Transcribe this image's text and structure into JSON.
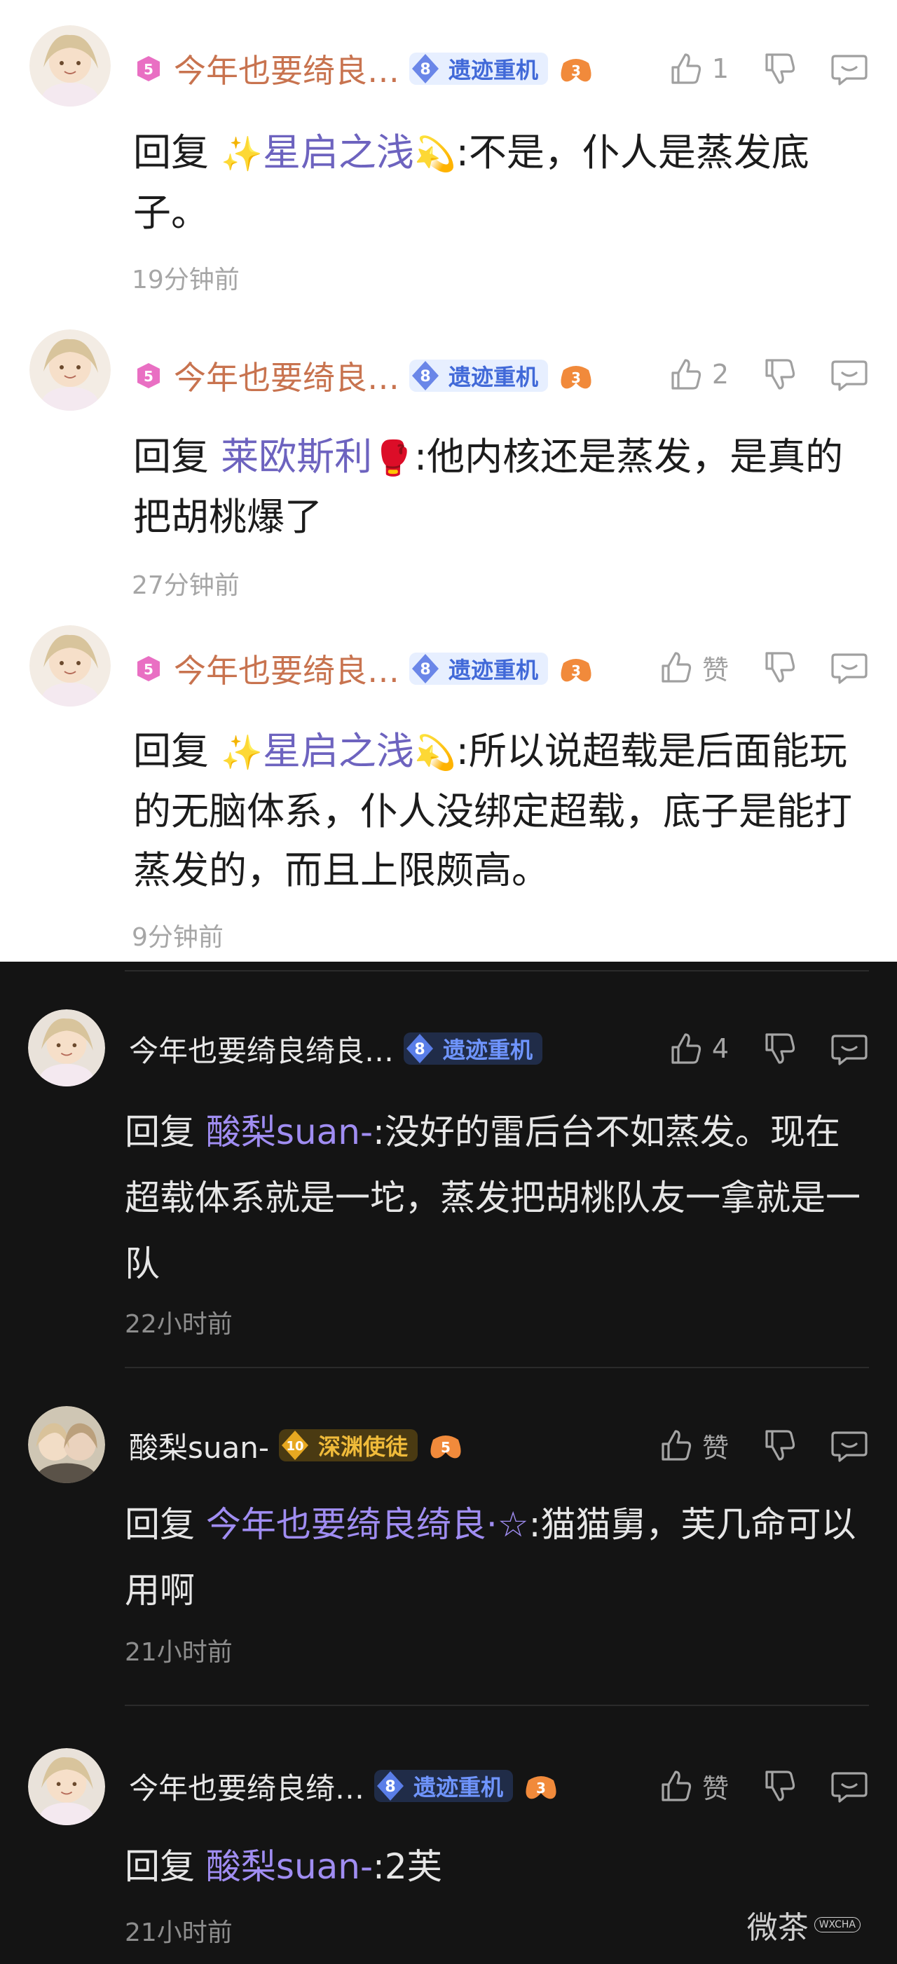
{
  "comments_light": [
    {
      "username": "今年也要绮良…",
      "badge_level": "8",
      "badge_label": "遗迹重机",
      "like_count": "1",
      "reply_prefix": "回复",
      "mention_before": "✨",
      "mention": "星启之浅",
      "mention_after": "💫",
      "content": ":不是，仆人是蒸发底子。",
      "time": "19分钟前"
    },
    {
      "username": "今年也要绮良…",
      "badge_level": "8",
      "badge_label": "遗迹重机",
      "like_count": "2",
      "reply_prefix": "回复",
      "mention_before": "",
      "mention": "莱欧斯利",
      "mention_after": "🥊",
      "content": ":他内核还是蒸发，是真的把胡桃爆了",
      "time": "27分钟前"
    },
    {
      "username": "今年也要绮良…",
      "badge_level": "8",
      "badge_label": "遗迹重机",
      "like_count": "赞",
      "reply_prefix": "回复",
      "mention_before": "✨",
      "mention": "星启之浅",
      "mention_after": "💫",
      "content": ":所以说超载是后面能玩的无脑体系，仆人没绑定超载，底子是能打蒸发的，而且上限颇高。",
      "time": "9分钟前"
    }
  ],
  "comments_dark": [
    {
      "username": "今年也要绮良绮良…",
      "badge_level": "8",
      "badge_label": "遗迹重机",
      "like_count": "4",
      "reply_prefix": "回复",
      "mention": "酸梨suan-",
      "content": ":没好的雷后台不如蒸发。现在超载体系就是一坨，蒸发把胡桃队友一拿就是一队",
      "time": "22小时前"
    },
    {
      "username": "酸梨suan-",
      "badge_level": "10",
      "badge_label": "深渊使徒",
      "like_count": "赞",
      "reply_prefix": "回复",
      "mention": "今年也要绮良绮良·☆",
      "content": ":猫猫舅，芙几命可以用啊",
      "time": "21小时前"
    },
    {
      "username": "今年也要绮良绮…",
      "badge_level": "8",
      "badge_label": "遗迹重机",
      "like_count": "赞",
      "reply_prefix": "回复",
      "mention": "酸梨suan-",
      "content": ":2芙",
      "time": "21小时前"
    }
  ],
  "watermark": {
    "text": "微茶",
    "tag": "WXCHA"
  },
  "colors": {
    "accent_mention": "#6d63bf",
    "username_light": "#c8734f",
    "badge_blue": "#4169d8",
    "badge_gold": "#f0bb3a",
    "dark_bg": "#141414"
  }
}
